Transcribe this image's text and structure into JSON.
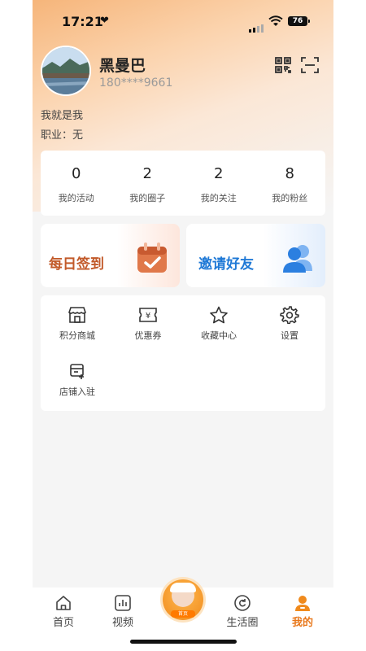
{
  "status_bar": {
    "time": "17:21",
    "heart": "❤",
    "battery": "76"
  },
  "profile": {
    "name": "黑曼巴",
    "phone": "180****9661",
    "bio": "我就是我",
    "job": "职业：无"
  },
  "stats": [
    {
      "value": "0",
      "label": "我的活动"
    },
    {
      "value": "2",
      "label": "我的圈子"
    },
    {
      "value": "2",
      "label": "我的关注"
    },
    {
      "value": "8",
      "label": "我的粉丝"
    }
  ],
  "cards": {
    "sign_in": "每日签到",
    "invite": "邀请好友"
  },
  "menu": [
    {
      "label": "积分商城",
      "icon": "store-icon"
    },
    {
      "label": "优惠券",
      "icon": "coupon-icon"
    },
    {
      "label": "收藏中心",
      "icon": "star-icon"
    },
    {
      "label": "设置",
      "icon": "gear-icon"
    },
    {
      "label": "店铺入驻",
      "icon": "shop-entry-icon"
    }
  ],
  "tabbar": {
    "items": [
      "首页",
      "视频",
      "生活圈",
      "我的"
    ],
    "center_badge": "首页"
  },
  "colors": {
    "accent": "#e8781c",
    "sign": "#c25a2a",
    "invite": "#1f79d6"
  }
}
